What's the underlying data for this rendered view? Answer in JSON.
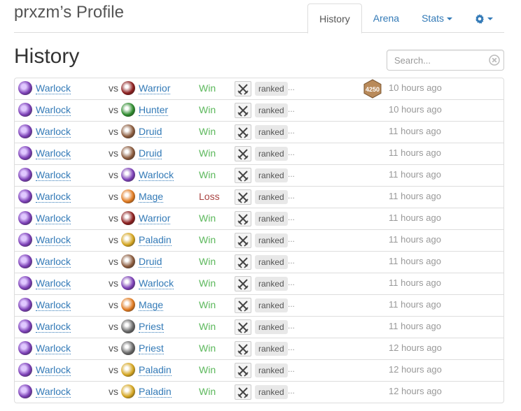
{
  "header": {
    "profile_title": "prxzm’s Profile",
    "tabs": [
      {
        "label": "History",
        "active": true
      },
      {
        "label": "Arena",
        "active": false
      },
      {
        "label": "Stats",
        "active": false,
        "dropdown": true
      }
    ],
    "settings_icon": "gear-icon"
  },
  "section_title": "History",
  "search": {
    "placeholder": "Search...",
    "value": ""
  },
  "colors": {
    "link": "#337ab7",
    "win": "#5cb85c",
    "loss": "#a94442",
    "muted": "#999999"
  },
  "class_icon_colors": {
    "Warlock": "#7b3fb5",
    "Warrior": "#8b1e1e",
    "Hunter": "#2e8b2e",
    "Druid": "#8a5a3c",
    "Mage": "#e07a20",
    "Paladin": "#d4a520",
    "Priest": "#666666"
  },
  "history": {
    "vs_label": "vs",
    "mode_badge": "ranked",
    "more_label": "...",
    "rows": [
      {
        "player": "Warlock",
        "opponent": "Warrior",
        "result": "Win",
        "rank": "4250",
        "time": "10 hours ago"
      },
      {
        "player": "Warlock",
        "opponent": "Hunter",
        "result": "Win",
        "time": "10 hours ago"
      },
      {
        "player": "Warlock",
        "opponent": "Druid",
        "result": "Win",
        "time": "11 hours ago"
      },
      {
        "player": "Warlock",
        "opponent": "Druid",
        "result": "Win",
        "time": "11 hours ago"
      },
      {
        "player": "Warlock",
        "opponent": "Warlock",
        "result": "Win",
        "time": "11 hours ago"
      },
      {
        "player": "Warlock",
        "opponent": "Mage",
        "result": "Loss",
        "time": "11 hours ago"
      },
      {
        "player": "Warlock",
        "opponent": "Warrior",
        "result": "Win",
        "time": "11 hours ago"
      },
      {
        "player": "Warlock",
        "opponent": "Paladin",
        "result": "Win",
        "time": "11 hours ago"
      },
      {
        "player": "Warlock",
        "opponent": "Druid",
        "result": "Win",
        "time": "11 hours ago"
      },
      {
        "player": "Warlock",
        "opponent": "Warlock",
        "result": "Win",
        "time": "11 hours ago"
      },
      {
        "player": "Warlock",
        "opponent": "Mage",
        "result": "Win",
        "time": "11 hours ago"
      },
      {
        "player": "Warlock",
        "opponent": "Priest",
        "result": "Win",
        "time": "11 hours ago"
      },
      {
        "player": "Warlock",
        "opponent": "Priest",
        "result": "Win",
        "time": "12 hours ago"
      },
      {
        "player": "Warlock",
        "opponent": "Paladin",
        "result": "Win",
        "time": "12 hours ago"
      },
      {
        "player": "Warlock",
        "opponent": "Paladin",
        "result": "Win",
        "time": "12 hours ago"
      }
    ]
  }
}
